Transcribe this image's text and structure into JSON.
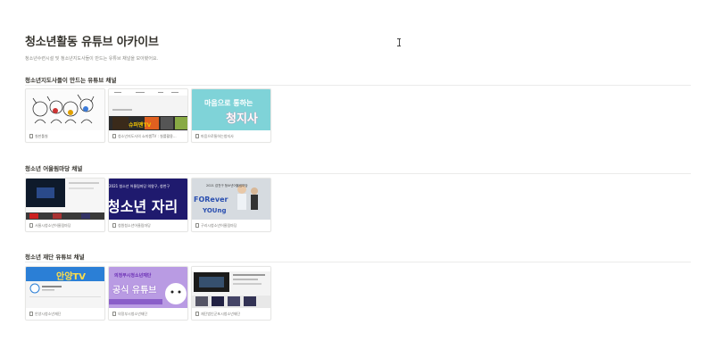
{
  "page": {
    "title": "청소년활동 유튜브 아카이브",
    "description": "청소년수련시설 및 청소년지도사들이 만드는 유튜브 채널을 모아봤어요."
  },
  "sections": [
    {
      "title": "청소년지도사들이 만드는 유튜브 채널",
      "cards": [
        {
          "title": "칠판툴칠"
        },
        {
          "title": "청소년지도사의 쇼미쌤TV : 칠를활용..."
        },
        {
          "title": "마음으로통하는청지사"
        }
      ]
    },
    {
      "title": "청소년 어울림마당 채널",
      "cards": [
        {
          "title": "서울시청소년어울림마당"
        },
        {
          "title": "청원청소년어울림마당"
        },
        {
          "title": "구리시청소년어울림마당"
        }
      ]
    },
    {
      "title": "청소년 재단 유튜브 채널",
      "cards": [
        {
          "title": "안양시청소년재단"
        },
        {
          "title": "의정부시청소년재단"
        },
        {
          "title": "재단법인군포시청소년재단"
        }
      ]
    }
  ],
  "thumb_text": {
    "s1c2_caption": "슈퍼맨TV",
    "s1c3_line1": "마음으로 통하는",
    "s1c3_line2": "청지사",
    "s2c2_top": "2021 청소년 어울림마당 의왕구, 청천구",
    "s2c2_big": "청소년 자리",
    "s2c3_small": "2021 감천구 청소년어울림마당",
    "s2c3_forever": "FORever",
    "s2c3_young": "YOUng",
    "s3c1_banner": "안양TV",
    "s3c2_line1": "의정부시청소년재단",
    "s3c2_line2": "공식 유튜브"
  },
  "colors": {
    "section_rule": "#ebebea",
    "teal_bg": "#7fd3d8",
    "navy_bg": "#1f1a6e",
    "purple_bg": "#b99be3"
  }
}
